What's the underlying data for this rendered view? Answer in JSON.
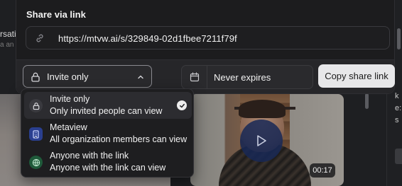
{
  "share": {
    "title": "Share via link",
    "url": "https://mtvw.ai/s/329849-02d1fbee7211f79f",
    "access": {
      "selected": "Invite only",
      "options": [
        {
          "title": "Invite only",
          "description": "Only invited people can view",
          "icon": "lock-icon",
          "selected": true
        },
        {
          "title": "Metaview",
          "description": "All organization members can view",
          "icon": "building-icon",
          "selected": false
        },
        {
          "title": "Anyone with the link",
          "description": "Anyone with the link can view",
          "icon": "globe-icon",
          "selected": false
        }
      ]
    },
    "expiry": {
      "value": "Never expires",
      "icon": "calendar-icon"
    },
    "copy_button_label": "Copy share link"
  },
  "background": {
    "left_snippet": "rsati",
    "left_snippet_muted": "a an",
    "video": {
      "duration": "00:17"
    }
  },
  "colors": {
    "panel_bg": "#1c1c1e",
    "option_selected_bg": "#2c2c30",
    "metaview_icon_bg": "#2a3f8f",
    "globe_icon_bg": "#1f5a3a",
    "copy_button_bg": "#e7e7e9"
  }
}
